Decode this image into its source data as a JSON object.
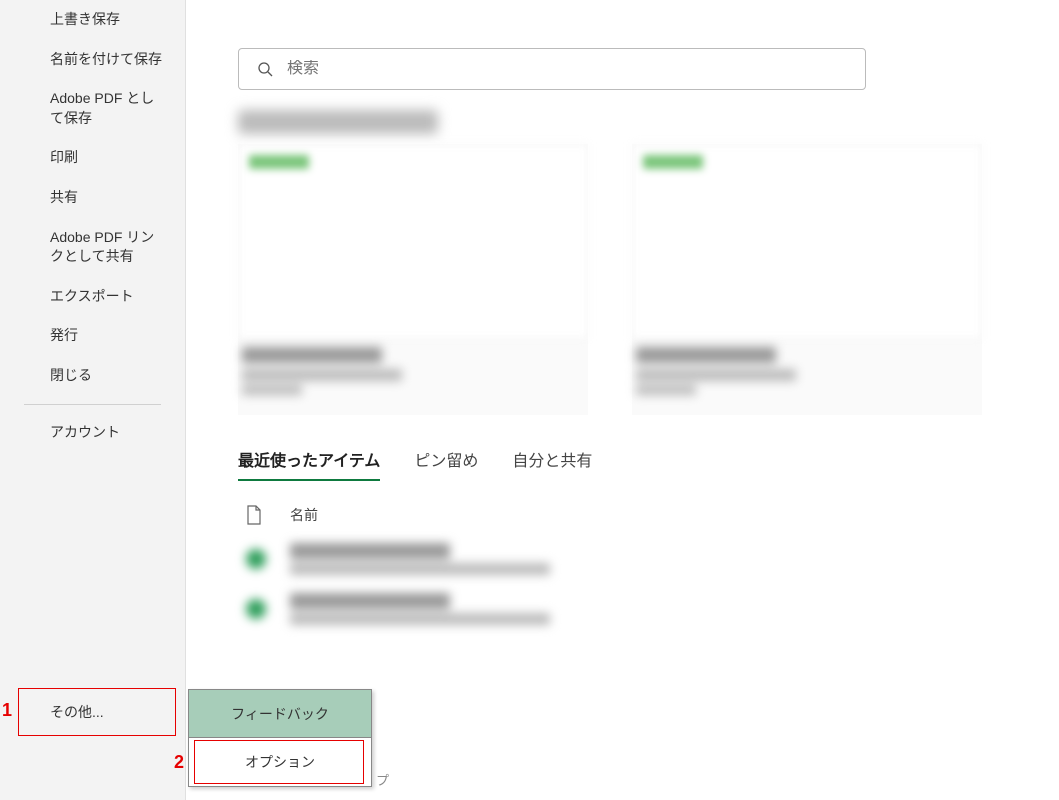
{
  "sidebar": {
    "items": [
      "上書き保存",
      "名前を付けて保存",
      "Adobe PDF として保存",
      "印刷",
      "共有",
      "Adobe PDF リンクとして共有",
      "エクスポート",
      "発行",
      "閉じる"
    ],
    "account": "アカウント",
    "more": "その他..."
  },
  "search": {
    "placeholder": "検索"
  },
  "tabs": {
    "recent": "最近使ったアイテム",
    "pinned": "ピン留め",
    "shared": "自分と共有"
  },
  "list": {
    "name_header": "名前"
  },
  "popup": {
    "feedback": "フィードバック",
    "options": "オプション"
  },
  "annotations": {
    "one": "1",
    "two": "2"
  },
  "fragment": "プ"
}
